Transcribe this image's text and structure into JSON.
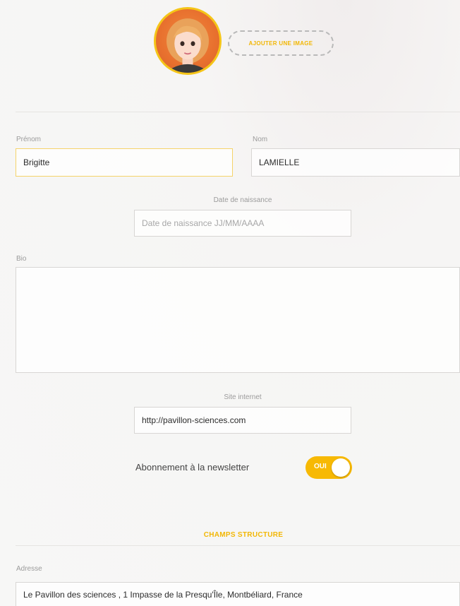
{
  "avatar": {
    "icon": "cartoon-woman-avatar",
    "accent": "#f5c518"
  },
  "add_image_label": "AJOUTER UNE IMAGE",
  "firstname": {
    "label": "Prénom",
    "value": "Brigitte"
  },
  "lastname": {
    "label": "Nom",
    "value": "LAMIELLE"
  },
  "birthdate": {
    "label": "Date de naissance",
    "placeholder": "Date de naissance JJ/MM/AAAA"
  },
  "bio": {
    "label": "Bio",
    "value": ""
  },
  "website": {
    "label": "Site internet",
    "value": "http://pavillon-sciences.com"
  },
  "newsletter": {
    "label": "Abonnement à la newsletter",
    "toggle_text": "OUI",
    "on": true,
    "color": "#f7b904"
  },
  "structure": {
    "title": "CHAMPS STRUCTURE"
  },
  "address": {
    "label": "Adresse",
    "value": "Le Pavillon des sciences , 1 Impasse de la Presqu'Île, Montbéliard, France"
  }
}
